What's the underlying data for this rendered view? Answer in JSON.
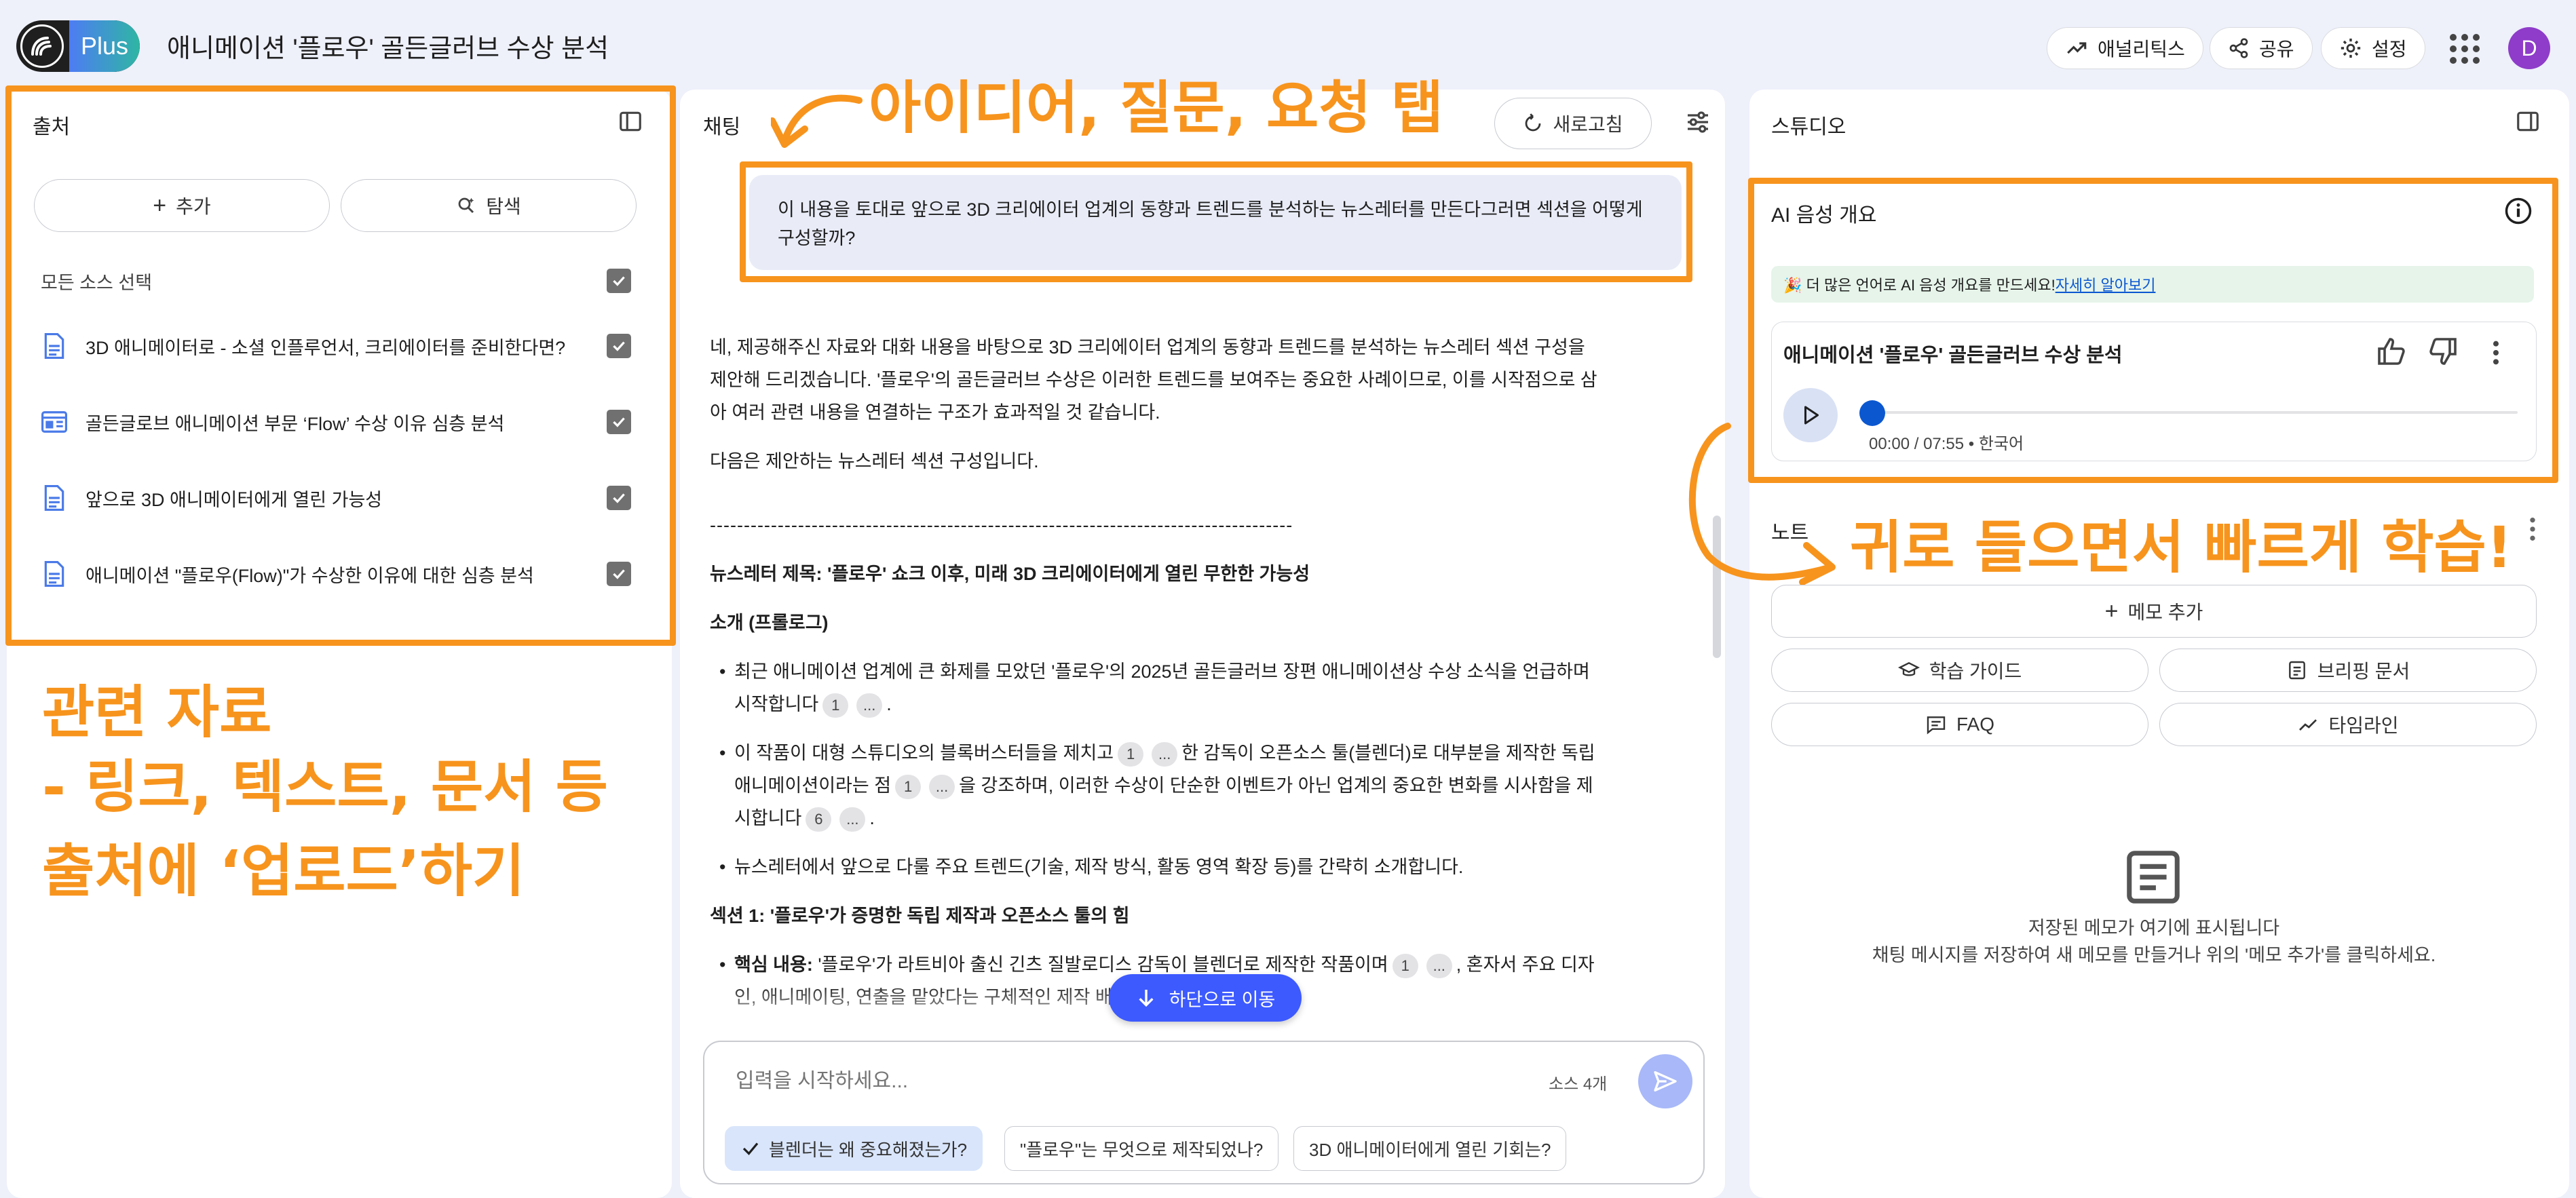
{
  "header": {
    "plan_badge": "Plus",
    "notebook_title": "애니메이션 '플로우' 골든글러브 수상 분석",
    "analytics_label": "애널리틱스",
    "share_label": "공유",
    "settings_label": "설정",
    "avatar_letter": "D"
  },
  "sources": {
    "title": "출처",
    "add_label": "추가",
    "explore_label": "탐색",
    "select_all_label": "모든 소스 선택",
    "items": [
      {
        "label": "3D 애니메이터로 - 소셜 인플루언서, 크리에이터를 준비한다면?",
        "icon": "document-icon"
      },
      {
        "label": "골든글로브 애니메이션 부문 ‘Flow’ 수상 이유 심층 분석",
        "icon": "web-page-icon"
      },
      {
        "label": "앞으로 3D 애니메이터에게 열린 가능성",
        "icon": "document-icon"
      },
      {
        "label": "애니메이션 \"플로우(Flow)\"가 수상한 이유에 대한 심층 분석",
        "icon": "document-icon"
      }
    ]
  },
  "chat": {
    "title": "채팅",
    "refresh_label": "새로고침",
    "user_message": "이 내용을 토대로 앞으로 3D 크리에이터 업계의 동향과 트렌드를 분석하는 뉴스레터를 만든다그러면 섹션을 어떻게 구성할까?",
    "response_intro": "네, 제공해주신 자료와 대화 내용을 바탕으로 3D 크리에이터 업계의 동향과 트렌드를 분석하는 뉴스레터 섹션 구성을 제안해 드리겠습니다. '플로우'의 골든글러브 수상은 이러한 트렌드를 보여주는 중요한 사례이므로, 이를 시작점으로 삼아 여러 관련 내용을 연결하는 구조가 효과적일 것 같습니다.",
    "response_lead": "다음은 제안하는 뉴스레터 섹션 구성입니다.",
    "divider": "--------------------------------------------------------------------------------------",
    "newsletter_title": "뉴스레터 제목: '플로우' 쇼크 이후, 미래 3D 크리에이터에게 열린 무한한 가능성",
    "intro_heading": "소개 (프롤로그)",
    "bullet1_a": "최근 애니메이션 업계에 큰 화제를 모았던 '플로우'의 2025년 골든글러브 장편 애니메이션상 수상 소식을 언급하며 시작합니다",
    "bullet2_a": "이 작품이 대형 스튜디오의 블록버스터들을 제치고",
    "bullet2_b": "한 감독이 오픈소스 툴(블렌더)로 대부분을 제작한 독립 애니메이션이라는 점",
    "bullet2_c": "을 강조하며, 이러한 수상이 단순한 이벤트가 아닌 업계의 중요한 변화를 시사함을 제시합니다",
    "bullet3": "뉴스레터에서 앞으로 다룰 주요 트렌드(기술, 제작 방식, 활동 영역 확장 등)를 간략히 소개합니다.",
    "section1_heading": "섹션 1: '플로우'가 증명한 독립 제작과 오픈소스 툴의 힘",
    "core_label": "핵심 내용:",
    "core_text_a": "'플로우'가 라트비아 출신 긴츠 질발로디스 감독이 블렌더로 제작한 작품이며",
    "core_text_b": ", 혼자서 주요 디자인, 애니메이팅, 연출을 맡았다는 구체적인 제작 배경을 설명합니다",
    "cite_1": "1",
    "cite_6": "6",
    "cite_more": "...",
    "scroll_down_label": "하단으로 이동",
    "input_placeholder": "입력을 시작하세요...",
    "source_count": "소스 4개",
    "suggestions": [
      "블렌더는 왜 중요해졌는가?",
      "\"플로우\"는 무엇으로 제작되었나?",
      "3D 애니메이터에게 열린 기회는?"
    ]
  },
  "studio": {
    "title": "스튜디오",
    "audio_title": "AI 음성 개요",
    "banner_text": "🎉 더 많은 언어로 AI 음성 개요를 만드세요!",
    "banner_link": "자세히 알아보기",
    "audio_card_title": "애니메이션 '플로우' 골든글러브 수상 분석",
    "progress": 0.0,
    "time_label": "00:00 / 07:55 • 한국어",
    "notes_title": "노트",
    "add_note_label": "메모 추가",
    "study_guide_label": "학습 가이드",
    "briefing_label": "브리핑 문서",
    "faq_label": "FAQ",
    "timeline_label": "타임라인",
    "empty_title": "저장된 메모가 여기에 표시됩니다",
    "empty_desc": "채팅 메시지를 저장하여 새 메모를 만들거나 위의 '메모 추가'를 클릭하세요."
  },
  "annotations": {
    "chat_tab_note": "아이디어, 질문, 요청 탭",
    "audio_note": "귀로 들으면서 빠르게 학습!",
    "sources_note_1": "관련 자료",
    "sources_note_2": "- 링크, 텍스트, 문서 등",
    "sources_note_3": "출처에 ‘업로드’하기"
  },
  "colors": {
    "accent": "#0b57d0",
    "annotation": "#f7941d",
    "scroll_button": "#3d5afe",
    "send_button": "#a8b8f8"
  }
}
